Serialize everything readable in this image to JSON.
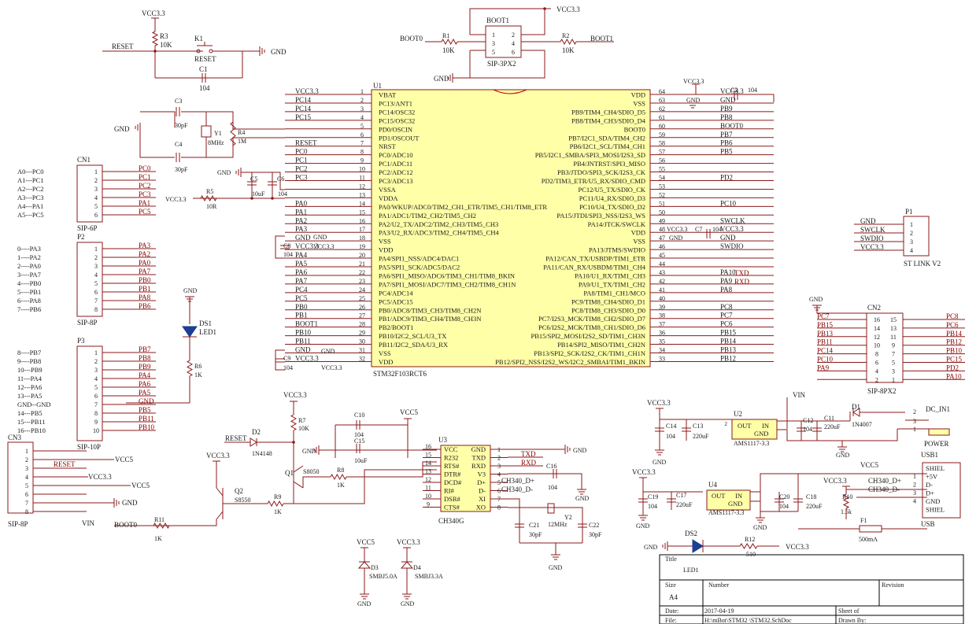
{
  "top": {
    "vcc_r3": "VCC3.3",
    "r3": "R3",
    "r3_val": "10K",
    "reset_net": "RESET",
    "k1": "K1",
    "k1_label": "RESET",
    "gnd_k1": "GND",
    "c1": "C1",
    "c1_val": "104",
    "boot_vcc": "VCC3.3",
    "boot1_ref": "BOOT1",
    "boot1_pins": [
      "1",
      "2",
      "3",
      "4",
      "5",
      "6"
    ],
    "boot1_pkg": "SIP-3PX2",
    "boot0_net": "BOOT0",
    "boot1_net": "BOOT1",
    "r1": "R1",
    "r1_val": "10K",
    "r2": "R2",
    "r2_val": "10K",
    "gnd_boot": "GND"
  },
  "osc": {
    "c3": "C3",
    "c3_val": "30pF",
    "c4": "C4",
    "c4_val": "30pF",
    "y1": "Y1",
    "y1_val": "8MHz",
    "r4": "R4",
    "r4_val": "1M",
    "gnd": "GND"
  },
  "mcu": {
    "ref": "U1",
    "part": "STM32F103RCT6",
    "left_pins": [
      {
        "num": "1",
        "name": "VBAT",
        "net": "VCC3.3"
      },
      {
        "num": "2",
        "name": "PC13/ANT1",
        "net": "PC14"
      },
      {
        "num": "3",
        "name": "PC14/OSC32",
        "net": "PC14"
      },
      {
        "num": "4",
        "name": "PC15/OSC32",
        "net": "PC15"
      },
      {
        "num": "5",
        "name": "PD0/OSCIN",
        "net": ""
      },
      {
        "num": "6",
        "name": "PD1/OSCOUT",
        "net": ""
      },
      {
        "num": "7",
        "name": "NRST",
        "net": "RESET"
      },
      {
        "num": "8",
        "name": "PC0/ADC10",
        "net": "PC0"
      },
      {
        "num": "9",
        "name": "PC1/ADC11",
        "net": "PC1"
      },
      {
        "num": "10",
        "name": "PC2/ADC12",
        "net": "PC2"
      },
      {
        "num": "11",
        "name": "PC3/ADC13",
        "net": "PC3"
      },
      {
        "num": "12",
        "name": "VSSA",
        "net": ""
      },
      {
        "num": "13",
        "name": "VDDA",
        "net": ""
      },
      {
        "num": "14",
        "name": "PA0/WKUP/ADC0/TIM2_CH1_ETR/TIM5_CH1/TIM8_ETR",
        "net": "PA0"
      },
      {
        "num": "15",
        "name": "PA1/ADC1/TIM2_CH2/TIM5_CH2",
        "net": "PA1"
      },
      {
        "num": "16",
        "name": "PA2/U2_TX/ADC2/TIM2_CH3/TIM5_CH3",
        "net": "PA2"
      },
      {
        "num": "17",
        "name": "PA3/U2_RX/ADC3/TIM2_CH4/TIM5_CH4",
        "net": "PA3"
      },
      {
        "num": "18",
        "name": "VSS",
        "net": "GND"
      },
      {
        "num": "19",
        "name": "VDD",
        "net": "VCC3.3"
      },
      {
        "num": "20",
        "name": "PA4/SPI1_NSS/ADC4/DAC1",
        "net": "PA4"
      },
      {
        "num": "21",
        "name": "PA5/SPI1_SCK/ADC5/DAC2",
        "net": "PA5"
      },
      {
        "num": "22",
        "name": "PA6/SPI1_MISO/ADC6/TIM3_CH1/TIM8_BKIN",
        "net": "PA6"
      },
      {
        "num": "23",
        "name": "PA7/SPI1_MOSI/ADC7/TIM3_CH2/TIM8_CH1N",
        "net": "PA7"
      },
      {
        "num": "24",
        "name": "PC4/ADC14",
        "net": "PC4"
      },
      {
        "num": "25",
        "name": "PC5/ADC15",
        "net": "PC5"
      },
      {
        "num": "26",
        "name": "PB0/ADC8/TIM3_CH3/TIM8_CH2N",
        "net": "PB0"
      },
      {
        "num": "27",
        "name": "PB1/ADC9/TIM3_CH4/TIM8_CH3N",
        "net": "PB1"
      },
      {
        "num": "28",
        "name": "PB2/BOOT1",
        "net": "BOOT1"
      },
      {
        "num": "29",
        "name": "PB10/I2C2_SCL/U3_TX",
        "net": "PB10"
      },
      {
        "num": "30",
        "name": "PB11/I2C2_SDA/U3_RX",
        "net": "PB11"
      },
      {
        "num": "31",
        "name": "VSS",
        "net": "GND"
      },
      {
        "num": "32",
        "name": "VDD",
        "net": "VCC3.3"
      }
    ],
    "right_pins": [
      {
        "num": "64",
        "name": "VDD",
        "net": "VCC3.3"
      },
      {
        "num": "63",
        "name": "VSS",
        "net": "GND"
      },
      {
        "num": "62",
        "name": "PB9/TIM4_CH4/SDIO_D5",
        "net": "PB9"
      },
      {
        "num": "61",
        "name": "PB8/TIM4_CH3/SDIO_D4",
        "net": "PB8"
      },
      {
        "num": "60",
        "name": "BOOT0",
        "net": "BOOT0"
      },
      {
        "num": "59",
        "name": "PB7/I2C1_SDA/TIM4_CH2",
        "net": "PB7"
      },
      {
        "num": "58",
        "name": "PB6/I2C1_SCL/TIM4_CH1",
        "net": "PB6"
      },
      {
        "num": "57",
        "name": "PB5/I2C1_SMBA/SPI3_MOSI/I2S3_SD",
        "net": "PB5"
      },
      {
        "num": "56",
        "name": "PB4/JNTRST/SPI3_MISO",
        "net": ""
      },
      {
        "num": "55",
        "name": "PB3/JTDO/SPI3_SCK/I2S3_CK",
        "net": ""
      },
      {
        "num": "54",
        "name": "PD2/TIM3_ETR/U5_RX/SDIO_CMD",
        "net": "PD2"
      },
      {
        "num": "53",
        "name": "PC12/U5_TX/SDIO_CK",
        "net": ""
      },
      {
        "num": "52",
        "name": "PC11/U4_RX/SDIO_D3",
        "net": ""
      },
      {
        "num": "51",
        "name": "PC10/U4_TX/SDIO_D2",
        "net": "PC10"
      },
      {
        "num": "50",
        "name": "PA15/JTDI/SPI3_NSS/I2S3_WS",
        "net": ""
      },
      {
        "num": "49",
        "name": "PA14/JTCK/SWCLK",
        "net": "SWCLK"
      },
      {
        "num": "48",
        "name": "VDD",
        "net": "VCC3.3"
      },
      {
        "num": "47",
        "name": "VSS",
        "net": "GND"
      },
      {
        "num": "46",
        "name": "PA13/JTMS/SWDIO",
        "net": "SWDIO"
      },
      {
        "num": "45",
        "name": "PA12/CAN_TX/USBDP/TIM1_ETR",
        "net": ""
      },
      {
        "num": "44",
        "name": "PA11/CAN_RX/USBDM/TIM1_CH4",
        "net": ""
      },
      {
        "num": "43",
        "name": "PA10/U1_RX/TIM1_CH3",
        "net": "PA10"
      },
      {
        "num": "42",
        "name": "PA9/U1_TX/TIM1_CH2",
        "net": "PA9"
      },
      {
        "num": "41",
        "name": "PA8/TIM1_CH1/MCO",
        "net": "PA8"
      },
      {
        "num": "40",
        "name": "PC9/TIM8_CH4/SDIO_D1",
        "net": ""
      },
      {
        "num": "39",
        "name": "PC8/TIM8_CH3/SDIO_D0",
        "net": "PC8"
      },
      {
        "num": "38",
        "name": "PC7/I2S3_MCK/TIM8_CH2/SDIO_D7",
        "net": "PC7"
      },
      {
        "num": "37",
        "name": "PC6/I2S2_MCK/TIM8_CH1/SDIO_D6",
        "net": "PC6"
      },
      {
        "num": "36",
        "name": "PB15/SPI2_MOSI/I2S2_SD/TIM1_CH3N",
        "net": "PB15"
      },
      {
        "num": "35",
        "name": "PB14/SPI2_MISO/TIM1_CH2N",
        "net": "PB14"
      },
      {
        "num": "34",
        "name": "PB13/SPI2_SCK/I2S2_CK/TIM1_CH1N",
        "net": "PB13"
      },
      {
        "num": "33",
        "name": "PB12/SPI2_NSS/I2S2_WS/I2C2_SMBAI/TIM1_BKIN",
        "net": "PB12"
      }
    ],
    "c2": "C2",
    "c2_val": "104",
    "c7": "C7",
    "c7_val": "104",
    "c5": "C5",
    "c5_val": "10uF",
    "c6": "C6",
    "c6_val": "104",
    "c8": "C8",
    "c8_val": "104",
    "c9": "C9",
    "c9_val": "104",
    "r5": "R5",
    "r5_val": "10R",
    "txd": "TXD",
    "rxd": "RXD",
    "vcc": "VCC3.3",
    "gnd": "GND"
  },
  "cn1": {
    "ref": "CN1",
    "pkg": "SIP-6P",
    "pins": [
      "1",
      "2",
      "3",
      "4",
      "5",
      "6"
    ],
    "nets": [
      "PC0",
      "PC1",
      "PC2",
      "PC3",
      "PA1",
      "PC5"
    ],
    "labels": [
      "A0---PC0",
      "A1---PC1",
      "A2---PC2",
      "A3---PC3",
      "A4---PA1",
      "A5---PC5"
    ]
  },
  "p2": {
    "ref": "P2",
    "pkg": "SIP-8P",
    "pins": [
      "1",
      "2",
      "3",
      "4",
      "5",
      "6",
      "7",
      "8"
    ],
    "nets": [
      "PA3",
      "PA2",
      "PA0",
      "PA7",
      "PB0",
      "PB1",
      "PA8",
      "PB6"
    ],
    "labels": [
      "0----PA3",
      "1----PA2",
      "2----PA0",
      "3----PA7",
      "4----PB0",
      "5----PB1",
      "6----PA8",
      "7----PB6"
    ]
  },
  "p3": {
    "ref": "P3",
    "pkg": "SIP-10P",
    "pins": [
      "1",
      "2",
      "3",
      "4",
      "5",
      "6",
      "7",
      "8",
      "9",
      "10"
    ],
    "nets": [
      "PB7",
      "PB8",
      "PB9",
      "PA4",
      "PA6",
      "PA5",
      "GND",
      "PB5",
      "PB11",
      "PB10"
    ],
    "labels": [
      "8----PB7",
      "9----PB8",
      "10---PB9",
      "11---PA4",
      "12---PA6",
      "13---PA5",
      "GND--GND",
      "14---PB5",
      "15---PB11",
      "16---PB10"
    ]
  },
  "cn3": {
    "ref": "CN3",
    "pkg": "SIP-8P",
    "pins": [
      "1",
      "2",
      "3",
      "4",
      "5",
      "6",
      "7",
      "8"
    ],
    "nets": [
      "",
      "VCC5",
      "RESET",
      "VCC3.3",
      "VCC5",
      "",
      "GND",
      "VIN"
    ]
  },
  "ds1": {
    "ref": "DS1",
    "val": "LED1",
    "r6": "R6",
    "r6_val": "1K",
    "gnd": "GND"
  },
  "p1": {
    "ref": "P1",
    "pkg": "ST LINK V2",
    "pins": [
      "1",
      "2",
      "3",
      "4"
    ],
    "nets": [
      "GND",
      "SWCLK",
      "SWDIO",
      "VCC3.3"
    ]
  },
  "cn2": {
    "ref": "CN2",
    "pkg": "SIP-8PX2",
    "left_pins": [
      "16",
      "14",
      "12",
      "10",
      "8",
      "6",
      "4",
      "2"
    ],
    "right_pins": [
      "15",
      "13",
      "11",
      "9",
      "7",
      "5",
      "3",
      "1"
    ],
    "left_nets": [
      "PC7",
      "PB15",
      "PB13",
      "PB11",
      "PC14",
      "PC10",
      "PA9",
      ""
    ],
    "right_nets": [
      "PC8",
      "PC6",
      "PB14",
      "PB12",
      "PB10",
      "PC15",
      "PD2",
      "PA10"
    ],
    "gnd": "GND"
  },
  "reset_ckt": {
    "reset": "RESET",
    "d2": "D2",
    "d2_val": "1N4148",
    "vcc": "VCC3.3",
    "r7": "R7",
    "r7_val": "10K",
    "q1": "Q1",
    "q1_val": "S8050",
    "r8": "R8",
    "r8_val": "1K",
    "r9": "R9",
    "r9_val": "1K",
    "q2": "Q2",
    "q2_val": "S8550",
    "r11": "R11",
    "r11_val": "1K",
    "boot0": "BOOT0",
    "gnd": "GND"
  },
  "ch340": {
    "ref": "U3",
    "part": "CH340G",
    "left_pins": [
      {
        "num": "16",
        "name": "VCC"
      },
      {
        "num": "15",
        "name": "R232"
      },
      {
        "num": "14",
        "name": "RTS#"
      },
      {
        "num": "13",
        "name": "DTR#"
      },
      {
        "num": "12",
        "name": "DCD#"
      },
      {
        "num": "11",
        "name": "RI#"
      },
      {
        "num": "10",
        "name": "DSR#"
      },
      {
        "num": "9",
        "name": "CTS#"
      }
    ],
    "right_pins": [
      {
        "num": "1",
        "name": "GND"
      },
      {
        "num": "2",
        "name": "TXD"
      },
      {
        "num": "3",
        "name": "RXD"
      },
      {
        "num": "4",
        "name": "V3"
      },
      {
        "num": "5",
        "name": "D+"
      },
      {
        "num": "6",
        "name": "D-"
      },
      {
        "num": "7",
        "name": "XI"
      },
      {
        "num": "8",
        "name": "XO"
      }
    ],
    "c10": "C10",
    "c10_val": "104",
    "c15": "C15",
    "c15_val": "10uF",
    "vcc5": "VCC5",
    "c16": "C16",
    "c16_val": "104",
    "txd": "TXD",
    "rxd": "RXD",
    "dp": "CH340_D+",
    "dm": "CH340_D-",
    "y2": "Y2",
    "y2_val": "12MHz",
    "c21": "C21",
    "c21_val": "30pF",
    "c22": "C22",
    "c22_val": "30pF",
    "gnd": "GND"
  },
  "tvs": {
    "vcc5": "VCC5",
    "d3": "D3",
    "d3_val": "SMBJ5.0A",
    "vcc33": "VCC3.3",
    "d4": "D4",
    "d4_val": "SMBJ3.3A",
    "gnd": "GND"
  },
  "power": {
    "vin": "VIN",
    "vcc33": "VCC3.3",
    "c14": "C14",
    "c14_val": "104",
    "c13": "C13",
    "c13_val": "220uF",
    "u2": "U2",
    "u2_part": "AMS1117-3.3",
    "u_out": "OUT",
    "u_in": "IN",
    "u_gnd": "GND",
    "c12": "C12",
    "c12_val": "104",
    "c11": "C11",
    "c11_val": "220uF",
    "d1": "D1",
    "d1_val": "1N4007",
    "dc": "DC_IN1",
    "dc_pins": [
      "2",
      "3",
      "1"
    ],
    "dc_label": "POWER",
    "vcc33b": "VCC3.3",
    "c19": "C19",
    "c19_val": "104",
    "c17": "C17",
    "c17_val": "220uF",
    "u4": "U4",
    "u4_part": "AMS1117-3.3",
    "vcc5": "VCC5",
    "c20": "C20",
    "c20_val": "104",
    "c18": "C18",
    "c18_val": "220uF",
    "r10": "R10",
    "r10_val": "1.5k",
    "r10_vcc": "VCC3.3",
    "dp": "CH340_D+",
    "dm": "CH340_D-",
    "f1": "F1",
    "f1_val": "500mA",
    "usb_ref": "USB1",
    "usb_label": "USB",
    "usb_pins": [
      "SHIEL",
      "+5V",
      "D-",
      "D+",
      "GND",
      "SHIEL"
    ],
    "usb_nums": [
      "1",
      "2",
      "3",
      "4"
    ],
    "ds2": "DS2",
    "ds2_val": "LED1",
    "r12": "R12",
    "r12_val": "510",
    "gnd": "GND"
  },
  "title_block": {
    "title_label": "Title",
    "size_label": "Size",
    "size_val": "A4",
    "number_label": "Number",
    "revision_label": "Revision",
    "date_label": "Date:",
    "date_val": "2017-04-19",
    "file_label": "File:",
    "file_val": "H:\\mBot\\STM32    \\STM32.SchDoc",
    "sheet_label": "Sheet    of",
    "drawn_label": "Drawn By:"
  },
  "colors": {
    "wire": "#8b1a1a",
    "ic_fill": "#ffffa8",
    "ic_border": "#8b1a1a",
    "text": "#1a1a1a",
    "net": "#8b0000",
    "led": "#1c3f94"
  }
}
